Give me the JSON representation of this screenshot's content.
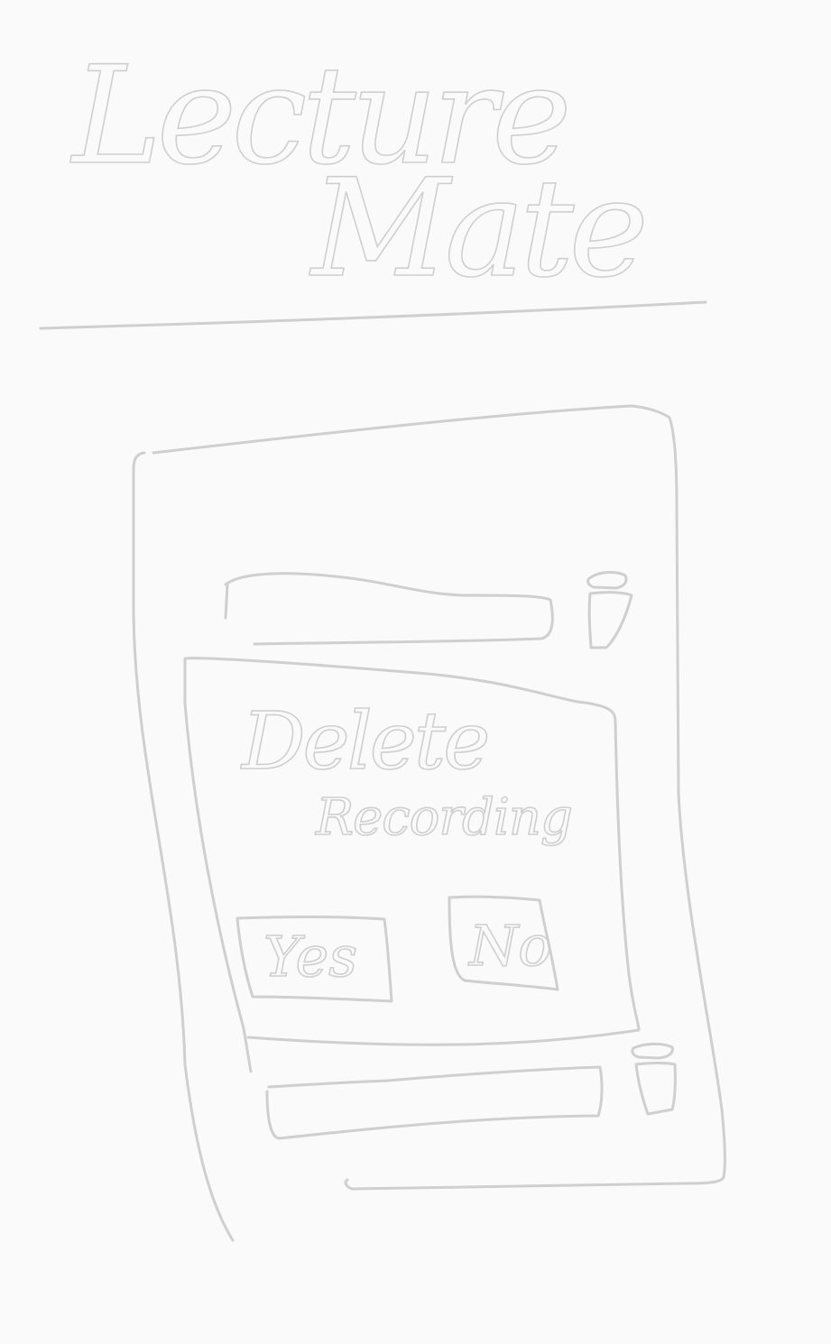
{
  "app": {
    "title_line1": "Lecture",
    "title_line2": "Mate"
  },
  "dialog": {
    "title": "Delete",
    "message": "Recording",
    "confirm_label": "Yes",
    "cancel_label": "No"
  },
  "list": {
    "items": [
      {
        "name": "",
        "delete_icon": "trash-icon"
      },
      {
        "name": "",
        "delete_icon": "trash-icon"
      }
    ]
  }
}
